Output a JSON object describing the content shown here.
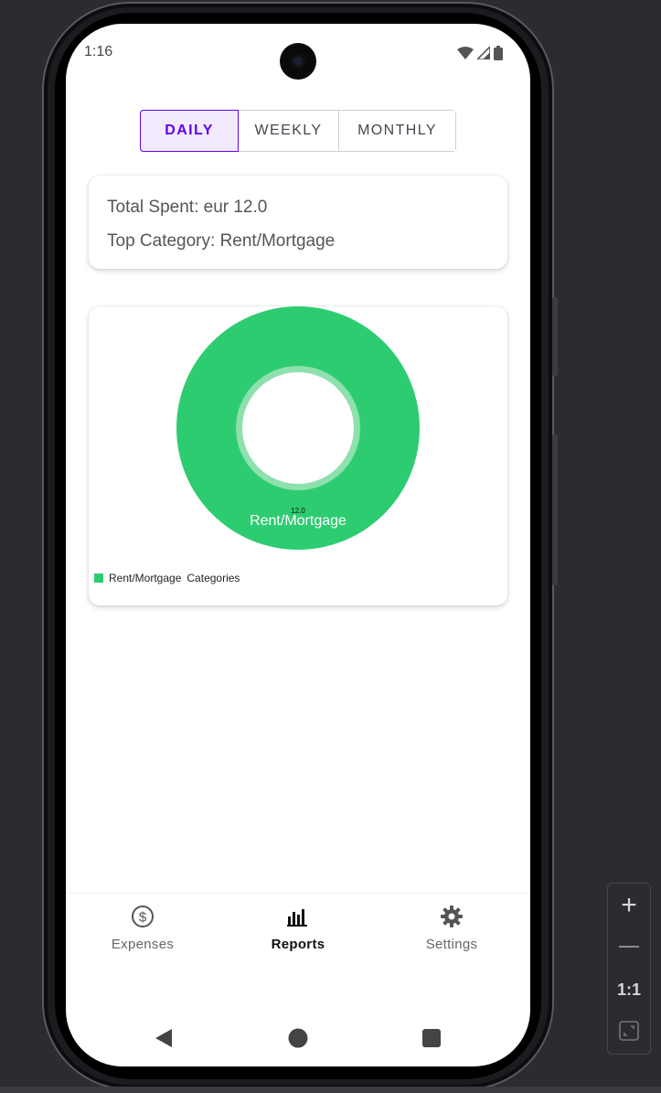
{
  "status_bar": {
    "time": "1:16"
  },
  "period_tabs": [
    {
      "label": "DAILY",
      "active": true
    },
    {
      "label": "WEEKLY",
      "active": false
    },
    {
      "label": "MONTHLY",
      "active": false
    }
  ],
  "summary": {
    "total_spent": "Total Spent: eur 12.0",
    "top_category": "Top Category: Rent/Mortgage"
  },
  "chart_data": {
    "type": "pie",
    "slices": [
      {
        "label": "Rent/Mortgage",
        "value": 12.0,
        "value_label": "12.0",
        "color": "#2ecc71"
      }
    ],
    "legend": {
      "entries": [
        "Rent/Mortgage"
      ],
      "title": "Categories",
      "placement": "bottom-left"
    },
    "hole": true
  },
  "bottom_nav": [
    {
      "label": "Expenses",
      "icon": "dollar-circle-icon",
      "active": false
    },
    {
      "label": "Reports",
      "icon": "bar-chart-icon",
      "active": true
    },
    {
      "label": "Settings",
      "icon": "gear-icon",
      "active": false
    }
  ],
  "emulator_panel": {
    "zoom_label": "1:1"
  },
  "colors": {
    "accent": "#6200ee",
    "chart_green": "#2ecc71",
    "inner_ring": "#8ee0ad"
  }
}
